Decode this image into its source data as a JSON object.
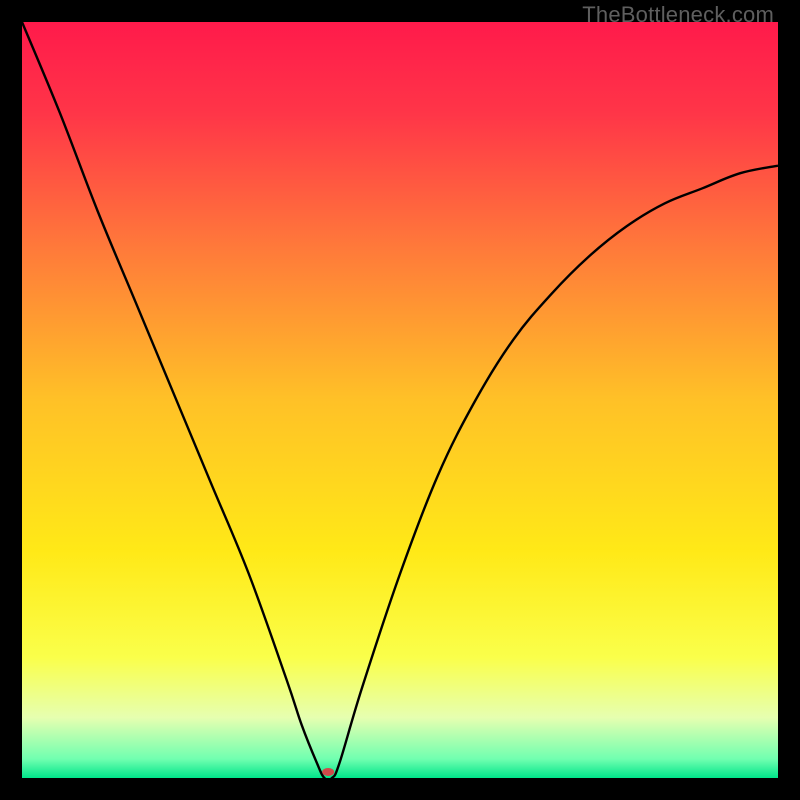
{
  "watermark": {
    "text": "TheBottleneck.com"
  },
  "chart_data": {
    "type": "line",
    "title": "",
    "xlabel": "",
    "ylabel": "",
    "xlim": [
      0,
      100
    ],
    "ylim": [
      0,
      100
    ],
    "grid": false,
    "legend": false,
    "background_gradient": {
      "stops": [
        {
          "pos": 0.0,
          "color": "#ff1a4b"
        },
        {
          "pos": 0.12,
          "color": "#ff3548"
        },
        {
          "pos": 0.3,
          "color": "#ff7a3a"
        },
        {
          "pos": 0.5,
          "color": "#ffc127"
        },
        {
          "pos": 0.7,
          "color": "#ffe917"
        },
        {
          "pos": 0.84,
          "color": "#faff4a"
        },
        {
          "pos": 0.92,
          "color": "#e6ffb0"
        },
        {
          "pos": 0.975,
          "color": "#70ffb0"
        },
        {
          "pos": 1.0,
          "color": "#00e58a"
        }
      ]
    },
    "series": [
      {
        "name": "bottleneck-curve",
        "x": [
          0,
          5,
          10,
          15,
          20,
          25,
          30,
          35,
          37,
          39,
          40,
          41,
          42,
          45,
          50,
          55,
          60,
          65,
          70,
          75,
          80,
          85,
          90,
          95,
          100
        ],
        "y": [
          100,
          88,
          75,
          63,
          51,
          39,
          27,
          13,
          7,
          2,
          0,
          0,
          2,
          12,
          27,
          40,
          50,
          58,
          64,
          69,
          73,
          76,
          78,
          80,
          81
        ]
      }
    ],
    "marker": {
      "x": 40.5,
      "y": 0.8,
      "color": "#d04a4a",
      "rx": 6,
      "ry": 4
    },
    "curve_color": "#000000",
    "curve_width": 2.4
  }
}
